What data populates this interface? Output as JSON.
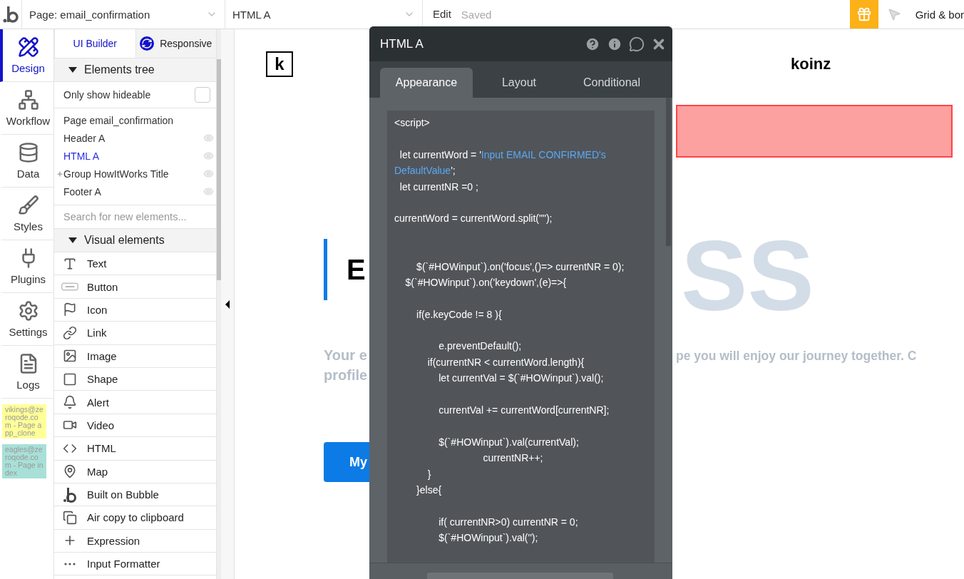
{
  "top_bar": {
    "page_dropdown": "Page: email_confirmation",
    "element_dropdown": "HTML A",
    "edit": "Edit",
    "status": "Saved",
    "grid_label": "Grid & bor"
  },
  "nav": [
    {
      "label": "Design",
      "kind": "design",
      "selected": true
    },
    {
      "label": "Workflow",
      "kind": "workflow",
      "selected": false
    },
    {
      "label": "Data",
      "kind": "data",
      "selected": false
    },
    {
      "label": "Styles",
      "kind": "styles",
      "selected": false
    },
    {
      "label": "Plugins",
      "kind": "plugins",
      "selected": false
    },
    {
      "label": "Settings",
      "kind": "settings",
      "selected": false
    },
    {
      "label": "Logs",
      "kind": "logs",
      "selected": false
    }
  ],
  "notes": [
    {
      "text": "vikings@zeroqode.com - Page app_clone",
      "color": "#ffff99"
    },
    {
      "text": "eagles@zeroqode.com - Page index",
      "color": "#a8e0d8"
    }
  ],
  "panel_tabs": [
    {
      "label": "UI Builder",
      "kind": "plain",
      "selected": true
    },
    {
      "label": "Responsive",
      "kind": "responsive",
      "selected": false
    }
  ],
  "elements_tree": {
    "title": "Elements tree",
    "expanded": true,
    "only_show_hideable": {
      "label": "Only show hideable",
      "checked": false
    },
    "items": [
      {
        "label": "Page email_confirmation",
        "kind": "page",
        "selected": false
      },
      {
        "label": "Header A",
        "kind": "element",
        "selected": false
      },
      {
        "label": "HTML A",
        "kind": "element",
        "selected": true
      },
      {
        "label": "Group HowItWorks Title",
        "kind": "group",
        "selected": false
      },
      {
        "label": "Footer A",
        "kind": "element",
        "selected": false
      }
    ]
  },
  "search": {
    "placeholder": "Search for new elements..."
  },
  "visual_elements": {
    "title": "Visual elements",
    "expanded": true,
    "items": [
      {
        "label": "Text",
        "kind": "text"
      },
      {
        "label": "Button",
        "kind": "button"
      },
      {
        "label": "Icon",
        "kind": "icon"
      },
      {
        "label": "Link",
        "kind": "link"
      },
      {
        "label": "Image",
        "kind": "image"
      },
      {
        "label": "Shape",
        "kind": "shape"
      },
      {
        "label": "Alert",
        "kind": "alert"
      },
      {
        "label": "Video",
        "kind": "video"
      },
      {
        "label": "HTML",
        "kind": "html"
      },
      {
        "label": "Map",
        "kind": "map"
      },
      {
        "label": "Built on Bubble",
        "kind": "bubble"
      },
      {
        "label": "Air copy to clipboard",
        "kind": "clipboard"
      },
      {
        "label": "Expression",
        "kind": "expression"
      },
      {
        "label": "Input Formatter",
        "kind": "formatter"
      }
    ]
  },
  "canvas": {
    "logo": "k",
    "brand": "koinz",
    "backdrop_text": "SS",
    "heading": "E",
    "text_left": [
      "Your e",
      "profile"
    ],
    "text_right": "pe you will enjoy our journey together. C",
    "button": "My"
  },
  "editor": {
    "title": "HTML A",
    "tabs": [
      {
        "label": "Appearance",
        "selected": true
      },
      {
        "label": "Layout",
        "selected": false
      },
      {
        "label": "Conditional",
        "selected": false
      }
    ],
    "code": [
      {
        "kind": "plain",
        "text": "<script>"
      },
      {
        "kind": "blank"
      },
      {
        "kind": "mixed",
        "segments": [
          {
            "kind": "plain",
            "text": "  let currentWord = '"
          },
          {
            "kind": "dynamic",
            "text": "Input EMAIL CONFIRMED's"
          }
        ]
      },
      {
        "kind": "mixed",
        "segments": [
          {
            "kind": "dynamic",
            "text": "DefaultValue"
          },
          {
            "kind": "plain",
            "text": "';"
          }
        ]
      },
      {
        "kind": "plain",
        "text": "  let currentNR =0 ;"
      },
      {
        "kind": "blank"
      },
      {
        "kind": "plain",
        "text": "currentWord = currentWord.split(\"\");"
      },
      {
        "kind": "blank"
      },
      {
        "kind": "blank"
      },
      {
        "kind": "plain",
        "text": "        $(`#HOWinput`).on('focus',()=> currentNR = 0);"
      },
      {
        "kind": "plain",
        "text": "    $(`#HOWinput`).on('keydown',(e)=>{"
      },
      {
        "kind": "blank"
      },
      {
        "kind": "plain",
        "text": "        if(e.keyCode != 8 ){"
      },
      {
        "kind": "blank"
      },
      {
        "kind": "plain",
        "text": "                e.preventDefault();"
      },
      {
        "kind": "plain",
        "text": "            if(currentNR < currentWord.length){"
      },
      {
        "kind": "plain",
        "text": "                let currentVal = $(`#HOWinput`).val();"
      },
      {
        "kind": "blank"
      },
      {
        "kind": "plain",
        "text": "                currentVal += currentWord[currentNR];"
      },
      {
        "kind": "blank"
      },
      {
        "kind": "plain",
        "text": "                $(`#HOWinput`).val(currentVal);"
      },
      {
        "kind": "plain",
        "text": "                                currentNR++;"
      },
      {
        "kind": "plain",
        "text": "            }"
      },
      {
        "kind": "plain",
        "text": "        }else{"
      },
      {
        "kind": "blank"
      },
      {
        "kind": "plain",
        "text": "                if( currentNR>0) currentNR = 0;"
      },
      {
        "kind": "plain",
        "text": "                $(`#HOWinput`).val('');"
      }
    ]
  }
}
